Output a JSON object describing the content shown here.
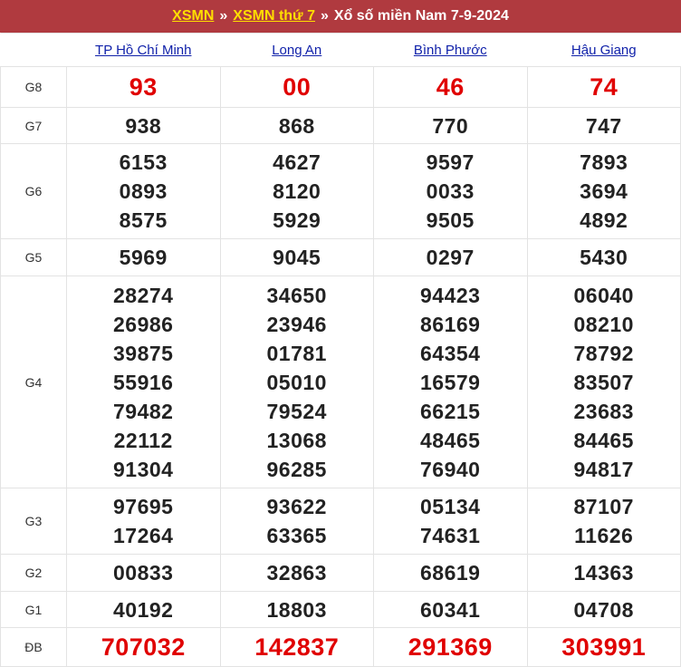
{
  "header": {
    "link1": "XSMN",
    "sep1": "»",
    "link2": "XSMN thứ 7",
    "sep2": "»",
    "title": "Xổ số miền Nam 7-9-2024"
  },
  "provinces": [
    "TP Hồ Chí Minh",
    "Long An",
    "Bình Phước",
    "Hậu Giang"
  ],
  "prizes": [
    {
      "label": "G8",
      "rows": [
        [
          "93",
          "00",
          "46",
          "74"
        ]
      ]
    },
    {
      "label": "G7",
      "rows": [
        [
          "938",
          "868",
          "770",
          "747"
        ]
      ]
    },
    {
      "label": "G6",
      "rows": [
        [
          "6153",
          "4627",
          "9597",
          "7893"
        ],
        [
          "0893",
          "8120",
          "0033",
          "3694"
        ],
        [
          "8575",
          "5929",
          "9505",
          "4892"
        ]
      ]
    },
    {
      "label": "G5",
      "rows": [
        [
          "5969",
          "9045",
          "0297",
          "5430"
        ]
      ]
    },
    {
      "label": "G4",
      "rows": [
        [
          "28274",
          "34650",
          "94423",
          "06040"
        ],
        [
          "26986",
          "23946",
          "86169",
          "08210"
        ],
        [
          "39875",
          "01781",
          "64354",
          "78792"
        ],
        [
          "55916",
          "05010",
          "16579",
          "83507"
        ],
        [
          "79482",
          "79524",
          "66215",
          "23683"
        ],
        [
          "22112",
          "13068",
          "48465",
          "84465"
        ],
        [
          "91304",
          "96285",
          "76940",
          "94817"
        ]
      ]
    },
    {
      "label": "G3",
      "rows": [
        [
          "97695",
          "93622",
          "05134",
          "87107"
        ],
        [
          "17264",
          "63365",
          "74631",
          "11626"
        ]
      ]
    },
    {
      "label": "G2",
      "rows": [
        [
          "00833",
          "32863",
          "68619",
          "14363"
        ]
      ]
    },
    {
      "label": "G1",
      "rows": [
        [
          "40192",
          "18803",
          "60341",
          "04708"
        ]
      ]
    },
    {
      "label": "ĐB",
      "rows": [
        [
          "707032",
          "142837",
          "291369",
          "303991"
        ]
      ]
    }
  ],
  "colors": {
    "header_bg": "#b03a3f",
    "header_link": "#ffde00",
    "province_link": "#1122aa",
    "highlight_number": "#e00000",
    "number": "#222222"
  }
}
